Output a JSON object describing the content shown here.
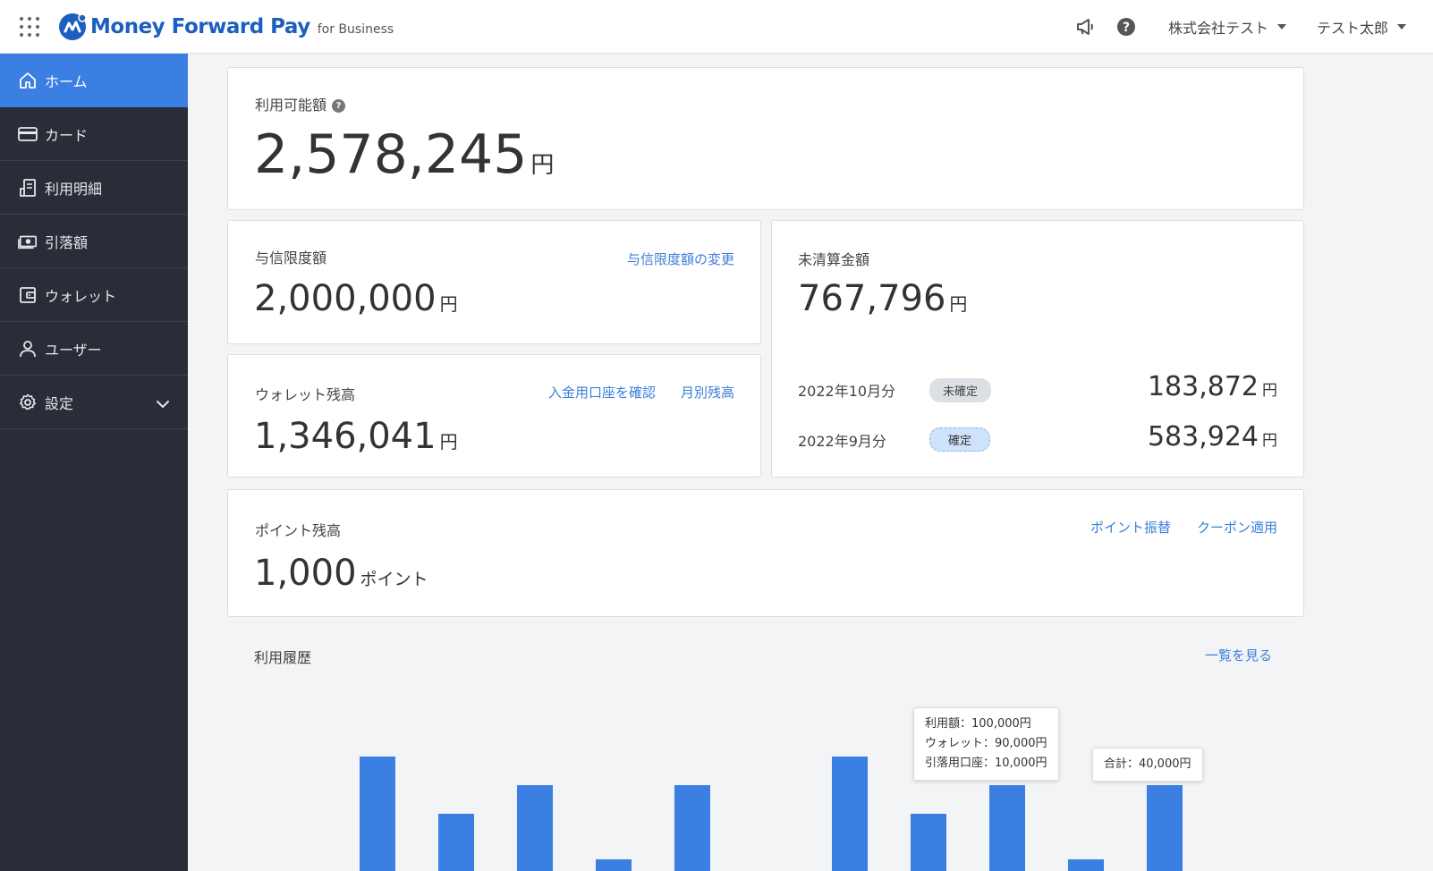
{
  "header": {
    "logo_text": "Money Forward Pay",
    "logo_sub": "for Business",
    "company": "株式会社テスト",
    "user": "テスト太郎"
  },
  "sidebar": {
    "items": [
      {
        "label": "ホーム",
        "icon": "home-icon",
        "active": true
      },
      {
        "label": "カード",
        "icon": "card-icon"
      },
      {
        "label": "利用明細",
        "icon": "receipt-icon"
      },
      {
        "label": "引落額",
        "icon": "money-icon"
      },
      {
        "label": "ウォレット",
        "icon": "wallet-icon"
      },
      {
        "label": "ユーザー",
        "icon": "user-icon"
      },
      {
        "label": "設定",
        "icon": "gear-icon"
      }
    ]
  },
  "available": {
    "label": "利用可能額",
    "amount": "2,578,245",
    "unit": "円"
  },
  "credit": {
    "label": "与信限度額",
    "link": "与信限度額の変更",
    "amount": "2,000,000",
    "unit": "円"
  },
  "wallet": {
    "label": "ウォレット残高",
    "link_account": "入金用口座を確認",
    "link_monthly": "月別残高",
    "amount": "1,346,041",
    "unit": "円"
  },
  "unsettled": {
    "label": "未清算金額",
    "amount": "767,796",
    "unit": "円",
    "rows": [
      {
        "month": "2022年10月分",
        "status": "未確定",
        "amount": "183,872",
        "unit": "円"
      },
      {
        "month": "2022年9月分",
        "status": "確定",
        "amount": "583,924",
        "unit": "円"
      }
    ]
  },
  "points": {
    "label": "ポイント残高",
    "link_transfer": "ポイント振替",
    "link_coupon": "クーポン適用",
    "amount": "1,000",
    "unit": "ポイント"
  },
  "history": {
    "label": "利用履歴",
    "link": "一覧を見る",
    "tooltip1": {
      "line1": "利用額：100,000円",
      "line2": "ウォレット：90,000円",
      "line3": "引落用口座：10,000円"
    },
    "tooltip2": "合計：40,000円"
  },
  "chart_data": {
    "type": "bar",
    "values": [
      100000,
      50000,
      75000,
      10000,
      75000,
      null,
      100000,
      50000,
      75000,
      10000,
      75000
    ],
    "color": "#3b7fe3"
  },
  "colors": {
    "accent": "#3b7fe3",
    "sidebar": "#282d37",
    "link": "#3a7fd9"
  }
}
